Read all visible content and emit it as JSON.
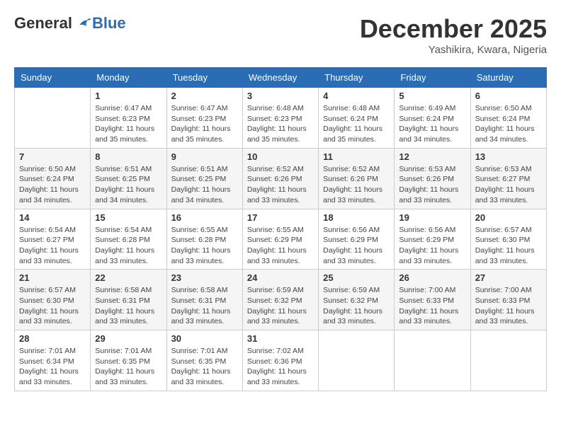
{
  "header": {
    "logo": {
      "general": "General",
      "blue": "Blue"
    },
    "title": "December 2025",
    "subtitle": "Yashikira, Kwara, Nigeria"
  },
  "days_of_week": [
    "Sunday",
    "Monday",
    "Tuesday",
    "Wednesday",
    "Thursday",
    "Friday",
    "Saturday"
  ],
  "weeks": [
    [
      {
        "day": "",
        "sunrise": "",
        "sunset": "",
        "daylight": ""
      },
      {
        "day": "1",
        "sunrise": "Sunrise: 6:47 AM",
        "sunset": "Sunset: 6:23 PM",
        "daylight": "Daylight: 11 hours and 35 minutes."
      },
      {
        "day": "2",
        "sunrise": "Sunrise: 6:47 AM",
        "sunset": "Sunset: 6:23 PM",
        "daylight": "Daylight: 11 hours and 35 minutes."
      },
      {
        "day": "3",
        "sunrise": "Sunrise: 6:48 AM",
        "sunset": "Sunset: 6:23 PM",
        "daylight": "Daylight: 11 hours and 35 minutes."
      },
      {
        "day": "4",
        "sunrise": "Sunrise: 6:48 AM",
        "sunset": "Sunset: 6:24 PM",
        "daylight": "Daylight: 11 hours and 35 minutes."
      },
      {
        "day": "5",
        "sunrise": "Sunrise: 6:49 AM",
        "sunset": "Sunset: 6:24 PM",
        "daylight": "Daylight: 11 hours and 34 minutes."
      },
      {
        "day": "6",
        "sunrise": "Sunrise: 6:50 AM",
        "sunset": "Sunset: 6:24 PM",
        "daylight": "Daylight: 11 hours and 34 minutes."
      }
    ],
    [
      {
        "day": "7",
        "sunrise": "Sunrise: 6:50 AM",
        "sunset": "Sunset: 6:24 PM",
        "daylight": "Daylight: 11 hours and 34 minutes."
      },
      {
        "day": "8",
        "sunrise": "Sunrise: 6:51 AM",
        "sunset": "Sunset: 6:25 PM",
        "daylight": "Daylight: 11 hours and 34 minutes."
      },
      {
        "day": "9",
        "sunrise": "Sunrise: 6:51 AM",
        "sunset": "Sunset: 6:25 PM",
        "daylight": "Daylight: 11 hours and 34 minutes."
      },
      {
        "day": "10",
        "sunrise": "Sunrise: 6:52 AM",
        "sunset": "Sunset: 6:26 PM",
        "daylight": "Daylight: 11 hours and 33 minutes."
      },
      {
        "day": "11",
        "sunrise": "Sunrise: 6:52 AM",
        "sunset": "Sunset: 6:26 PM",
        "daylight": "Daylight: 11 hours and 33 minutes."
      },
      {
        "day": "12",
        "sunrise": "Sunrise: 6:53 AM",
        "sunset": "Sunset: 6:26 PM",
        "daylight": "Daylight: 11 hours and 33 minutes."
      },
      {
        "day": "13",
        "sunrise": "Sunrise: 6:53 AM",
        "sunset": "Sunset: 6:27 PM",
        "daylight": "Daylight: 11 hours and 33 minutes."
      }
    ],
    [
      {
        "day": "14",
        "sunrise": "Sunrise: 6:54 AM",
        "sunset": "Sunset: 6:27 PM",
        "daylight": "Daylight: 11 hours and 33 minutes."
      },
      {
        "day": "15",
        "sunrise": "Sunrise: 6:54 AM",
        "sunset": "Sunset: 6:28 PM",
        "daylight": "Daylight: 11 hours and 33 minutes."
      },
      {
        "day": "16",
        "sunrise": "Sunrise: 6:55 AM",
        "sunset": "Sunset: 6:28 PM",
        "daylight": "Daylight: 11 hours and 33 minutes."
      },
      {
        "day": "17",
        "sunrise": "Sunrise: 6:55 AM",
        "sunset": "Sunset: 6:29 PM",
        "daylight": "Daylight: 11 hours and 33 minutes."
      },
      {
        "day": "18",
        "sunrise": "Sunrise: 6:56 AM",
        "sunset": "Sunset: 6:29 PM",
        "daylight": "Daylight: 11 hours and 33 minutes."
      },
      {
        "day": "19",
        "sunrise": "Sunrise: 6:56 AM",
        "sunset": "Sunset: 6:29 PM",
        "daylight": "Daylight: 11 hours and 33 minutes."
      },
      {
        "day": "20",
        "sunrise": "Sunrise: 6:57 AM",
        "sunset": "Sunset: 6:30 PM",
        "daylight": "Daylight: 11 hours and 33 minutes."
      }
    ],
    [
      {
        "day": "21",
        "sunrise": "Sunrise: 6:57 AM",
        "sunset": "Sunset: 6:30 PM",
        "daylight": "Daylight: 11 hours and 33 minutes."
      },
      {
        "day": "22",
        "sunrise": "Sunrise: 6:58 AM",
        "sunset": "Sunset: 6:31 PM",
        "daylight": "Daylight: 11 hours and 33 minutes."
      },
      {
        "day": "23",
        "sunrise": "Sunrise: 6:58 AM",
        "sunset": "Sunset: 6:31 PM",
        "daylight": "Daylight: 11 hours and 33 minutes."
      },
      {
        "day": "24",
        "sunrise": "Sunrise: 6:59 AM",
        "sunset": "Sunset: 6:32 PM",
        "daylight": "Daylight: 11 hours and 33 minutes."
      },
      {
        "day": "25",
        "sunrise": "Sunrise: 6:59 AM",
        "sunset": "Sunset: 6:32 PM",
        "daylight": "Daylight: 11 hours and 33 minutes."
      },
      {
        "day": "26",
        "sunrise": "Sunrise: 7:00 AM",
        "sunset": "Sunset: 6:33 PM",
        "daylight": "Daylight: 11 hours and 33 minutes."
      },
      {
        "day": "27",
        "sunrise": "Sunrise: 7:00 AM",
        "sunset": "Sunset: 6:33 PM",
        "daylight": "Daylight: 11 hours and 33 minutes."
      }
    ],
    [
      {
        "day": "28",
        "sunrise": "Sunrise: 7:01 AM",
        "sunset": "Sunset: 6:34 PM",
        "daylight": "Daylight: 11 hours and 33 minutes."
      },
      {
        "day": "29",
        "sunrise": "Sunrise: 7:01 AM",
        "sunset": "Sunset: 6:35 PM",
        "daylight": "Daylight: 11 hours and 33 minutes."
      },
      {
        "day": "30",
        "sunrise": "Sunrise: 7:01 AM",
        "sunset": "Sunset: 6:35 PM",
        "daylight": "Daylight: 11 hours and 33 minutes."
      },
      {
        "day": "31",
        "sunrise": "Sunrise: 7:02 AM",
        "sunset": "Sunset: 6:36 PM",
        "daylight": "Daylight: 11 hours and 33 minutes."
      },
      {
        "day": "",
        "sunrise": "",
        "sunset": "",
        "daylight": ""
      },
      {
        "day": "",
        "sunrise": "",
        "sunset": "",
        "daylight": ""
      },
      {
        "day": "",
        "sunrise": "",
        "sunset": "",
        "daylight": ""
      }
    ]
  ]
}
